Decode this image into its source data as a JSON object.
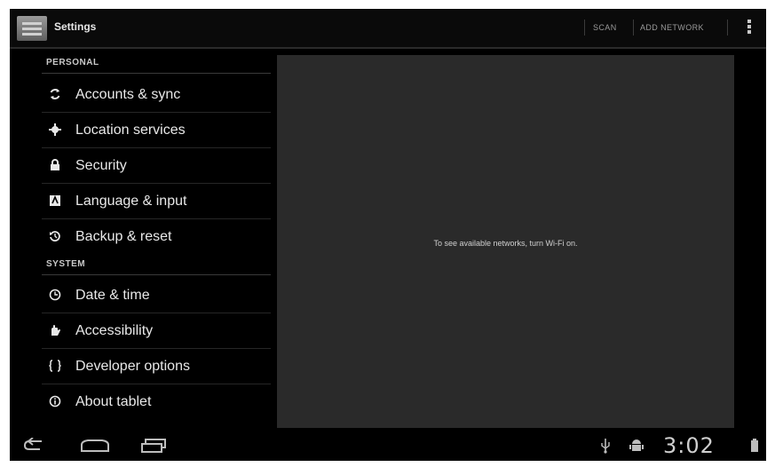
{
  "actionbar": {
    "title": "Settings",
    "scan_label": "SCAN",
    "add_network_label": "ADD NETWORK",
    "icon": "settings-app-icon",
    "overflow_icon": "overflow-menu-icon"
  },
  "sidebar": {
    "sections": [
      {
        "header": "PERSONAL",
        "items": [
          {
            "label": "Accounts & sync",
            "icon": "sync-icon"
          },
          {
            "label": "Location services",
            "icon": "location-icon"
          },
          {
            "label": "Security",
            "icon": "lock-icon"
          },
          {
            "label": "Language & input",
            "icon": "keyboard-icon"
          },
          {
            "label": "Backup & reset",
            "icon": "backup-icon"
          }
        ]
      },
      {
        "header": "SYSTEM",
        "items": [
          {
            "label": "Date & time",
            "icon": "clock-icon"
          },
          {
            "label": "Accessibility",
            "icon": "hand-icon"
          },
          {
            "label": "Developer options",
            "icon": "braces-icon"
          },
          {
            "label": "About tablet",
            "icon": "info-icon"
          }
        ]
      }
    ]
  },
  "content": {
    "message": "To see available networks, turn Wi-Fi on."
  },
  "navbar": {
    "back_icon": "back-icon",
    "home_icon": "home-icon",
    "recents_icon": "recents-icon",
    "usb_icon": "usb-icon",
    "debug_icon": "android-debug-icon",
    "time": "3:02",
    "battery_icon": "battery-icon"
  },
  "colors": {
    "background": "#000000",
    "content_panel": "#2a2a2a",
    "text": "#e8e8e8"
  }
}
